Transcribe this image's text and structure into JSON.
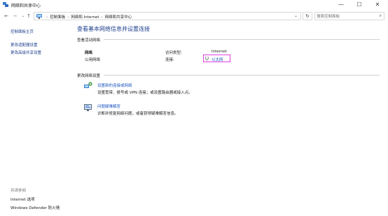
{
  "window": {
    "title": "网络和共享中心",
    "minimize": "—",
    "maximize": "☐",
    "close": "✕"
  },
  "nav": {
    "back": "←",
    "forward": "→",
    "recent": "⌄",
    "up": "↑",
    "breadcrumbs": [
      "控制面板",
      "网络和 Internet",
      "网络和共享中心"
    ],
    "separator": "›",
    "dropdown": "⌄",
    "refresh": "↻"
  },
  "search": {
    "placeholder": "搜索控制面板",
    "icon": "⌕"
  },
  "sidebar": {
    "home": "控制面板主页",
    "adapter_settings": "更改适配器设置",
    "advanced_sharing": "更改高级共享设置",
    "see_also_title": "另请参阅",
    "see_also": [
      "Internet 选项",
      "Windows Defender 防火墙"
    ]
  },
  "main": {
    "title": "查看基本网络信息并设置连接",
    "active_networks_label": "查看活动网络",
    "network": {
      "name": "网络",
      "type": "公用网络",
      "access_type_label": "访问类型:",
      "access_type_value": "Internet",
      "connections_label": "连接:",
      "connection_name": "以太网"
    },
    "change_settings_label": "更改网络设置",
    "tasks": [
      {
        "title": "设置新的连接或网络",
        "description": "设置宽带、拨号或 VPN 连接；或设置路由器或接入点。"
      },
      {
        "title": "问题疑难解答",
        "description": "诊断并修复网络问题，或者获得疑难解答信息。"
      }
    ]
  },
  "colors": {
    "link": "#1a55c0",
    "title": "#1e3f8f",
    "highlight_border": "#e040e0"
  }
}
